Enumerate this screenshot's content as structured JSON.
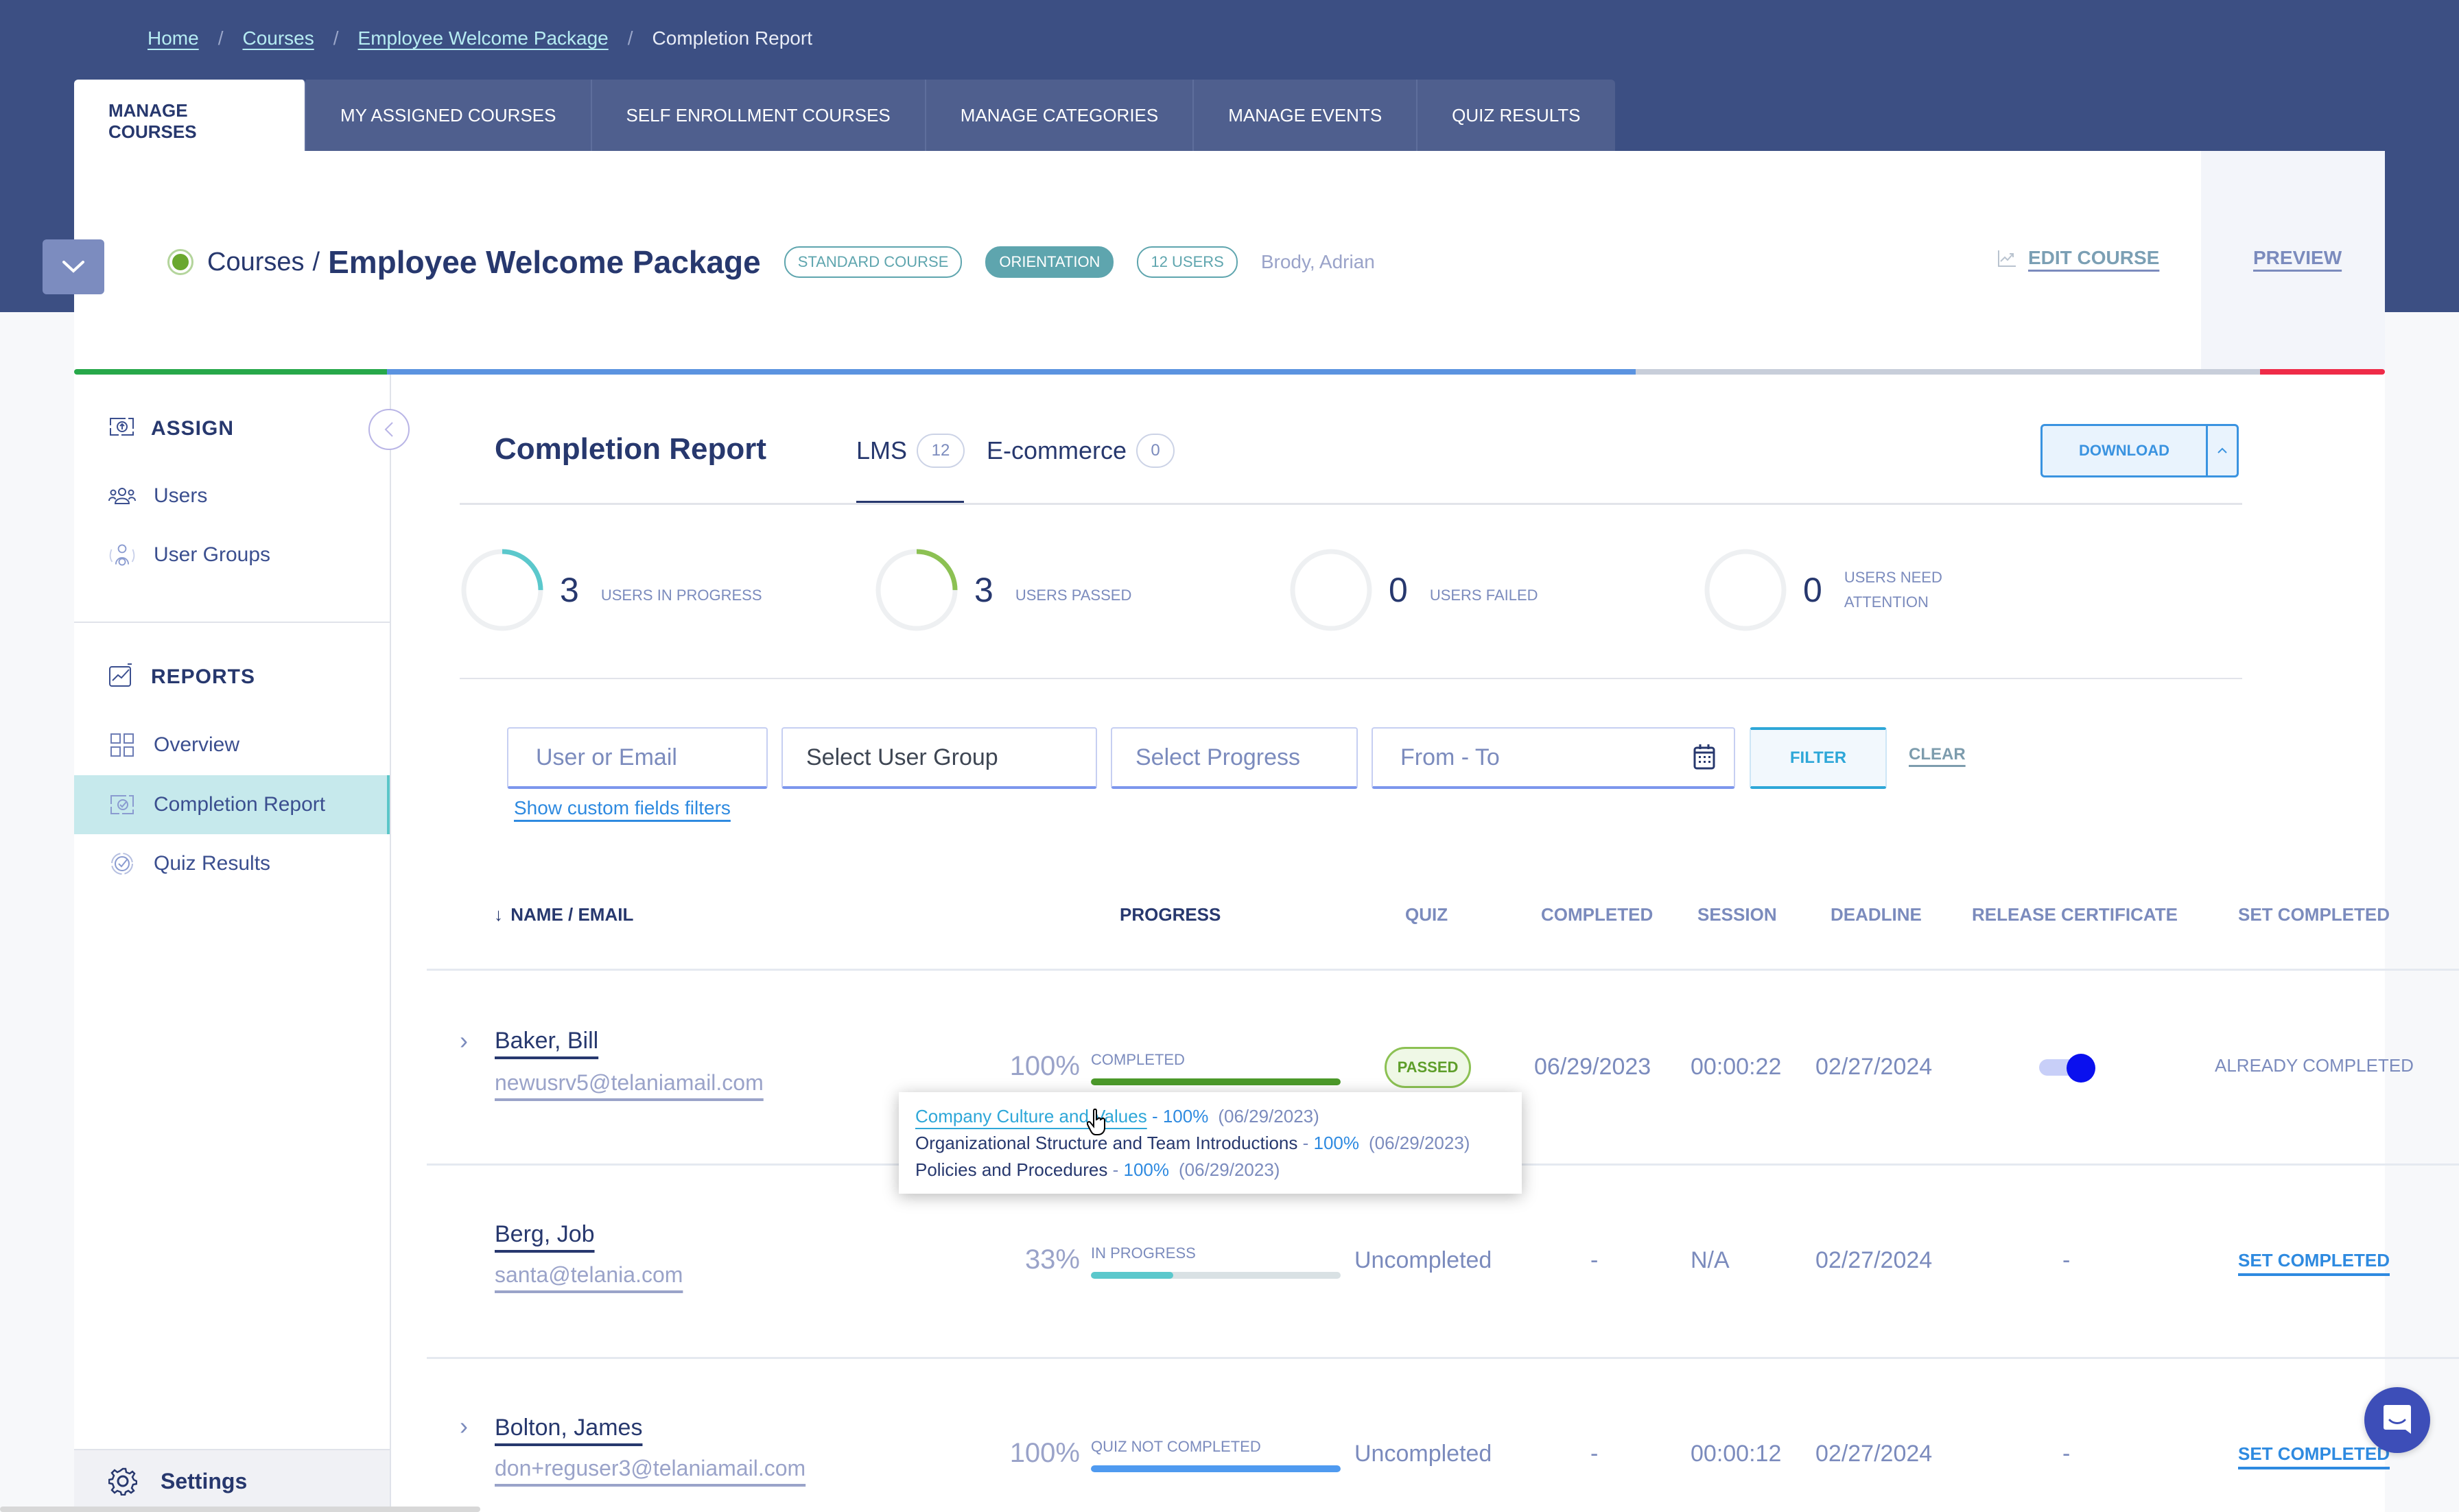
{
  "breadcrumb": [
    {
      "label": "Home",
      "link": true
    },
    {
      "label": "Courses",
      "link": true
    },
    {
      "label": "Employee Welcome Package",
      "link": true
    },
    {
      "label": "Completion Report",
      "link": false
    }
  ],
  "top_tabs": [
    {
      "label": "MANAGE COURSES",
      "active": true
    },
    {
      "label": "MY ASSIGNED COURSES",
      "active": false
    },
    {
      "label": "SELF ENROLLMENT COURSES",
      "active": false
    },
    {
      "label": "MANAGE CATEGORIES",
      "active": false
    },
    {
      "label": "MANAGE EVENTS",
      "active": false
    },
    {
      "label": "QUIZ RESULTS",
      "active": false
    }
  ],
  "course": {
    "crumb_parent": "Courses",
    "crumb_separator": "/",
    "title": "Employee Welcome Package",
    "pills": [
      "STANDARD COURSE",
      "ORIENTATION",
      "12 USERS"
    ],
    "owner": "Brody, Adrian",
    "edit_label": "EDIT COURSE",
    "preview_label": "PREVIEW",
    "status_color": "#6aa82e"
  },
  "status_bar_colors": [
    "#27a84a",
    "#5b93e0",
    "#c8ceda",
    "#ef2b48"
  ],
  "sidebar": {
    "sections": [
      {
        "title": "ASSIGN",
        "icon": "assign-icon",
        "items": [
          {
            "label": "Users",
            "icon": "users-icon",
            "active": false
          },
          {
            "label": "User Groups",
            "icon": "user-groups-icon",
            "active": false
          }
        ]
      },
      {
        "title": "REPORTS",
        "icon": "reports-chart-icon",
        "items": [
          {
            "label": "Overview",
            "icon": "grid-icon",
            "active": false
          },
          {
            "label": "Completion Report",
            "icon": "completion-report-icon",
            "active": true
          },
          {
            "label": "Quiz Results",
            "icon": "quiz-results-icon",
            "active": false
          }
        ]
      }
    ],
    "settings_label": "Settings"
  },
  "report": {
    "title": "Completion Report",
    "tabs": [
      {
        "label": "LMS",
        "count": "12",
        "active": true
      },
      {
        "label": "E-commerce",
        "count": "0",
        "active": false
      }
    ],
    "download_label": "DOWNLOAD",
    "download_caret": "^"
  },
  "stats": [
    {
      "value": "3",
      "label": "USERS IN PROGRESS",
      "fraction": 0.25,
      "color": "#5bc8cc"
    },
    {
      "value": "3",
      "label": "USERS PASSED",
      "fraction": 0.25,
      "color": "#8cc153"
    },
    {
      "value": "0",
      "label": "USERS FAILED",
      "fraction": 0,
      "color": "#e2e4ea"
    },
    {
      "value": "0",
      "label": "USERS NEED ATTENTION",
      "label_line1": "USERS NEED",
      "label_line2": "ATTENTION",
      "fraction": 0,
      "color": "#e2e4ea"
    }
  ],
  "filters": {
    "user_placeholder": "User or Email",
    "group_value": "Select User Group",
    "progress_placeholder": "Select Progress",
    "date_placeholder": "From - To",
    "filter_label": "FILTER",
    "clear_label": "CLEAR",
    "custom_fields_label": "Show custom fields filters"
  },
  "table": {
    "sort_arrow": "↓",
    "columns": [
      "NAME / EMAIL",
      "PROGRESS",
      "QUIZ",
      "COMPLETED",
      "SESSION",
      "DEADLINE",
      "RELEASE CERTIFICATE",
      "SET COMPLETED"
    ],
    "rows": [
      {
        "name": "Baker, Bill",
        "email": "newusrv5@telaniamail.com",
        "expandable": true,
        "progress_pct": "100%",
        "progress_value": 1.0,
        "progress_status": "COMPLETED",
        "progress_color": "#4c9a2a",
        "quiz": "PASSED",
        "completed": "06/29/2023",
        "session": "00:00:22",
        "deadline": "02/27/2024",
        "release_certificate": "on",
        "set_completed": "ALREADY COMPLETED"
      },
      {
        "name": "Berg, Job",
        "email": "santa@telania.com",
        "expandable": false,
        "progress_pct": "33%",
        "progress_value": 0.33,
        "progress_status": "IN PROGRESS",
        "progress_color": "#5bc8cc",
        "quiz": "Uncompleted",
        "completed": "-",
        "session": "N/A",
        "deadline": "02/27/2024",
        "release_certificate": "-",
        "set_completed": "SET COMPLETED"
      },
      {
        "name": "Bolton, James",
        "email": "don+reguser3@telaniamail.com",
        "expandable": true,
        "progress_pct": "100%",
        "progress_value": 1.0,
        "progress_status": "QUIZ NOT COMPLETED",
        "progress_color": "#4f9af0",
        "quiz": "Uncompleted",
        "completed": "-",
        "session": "00:00:12",
        "deadline": "02/27/2024",
        "release_certificate": "-",
        "set_completed": "SET COMPLETED"
      }
    ]
  },
  "tooltip": {
    "items": [
      {
        "course": "Company Culture and Values",
        "pct": "100%",
        "date": "(06/29/2023)",
        "link": true
      },
      {
        "course": "Organizational Structure and Team Introductions",
        "pct": "100%",
        "date": "(06/29/2023)",
        "link": false
      },
      {
        "course": "Policies and Procedures",
        "pct": "100%",
        "date": "(06/29/2023)",
        "link": false
      }
    ],
    "dash": " - "
  }
}
